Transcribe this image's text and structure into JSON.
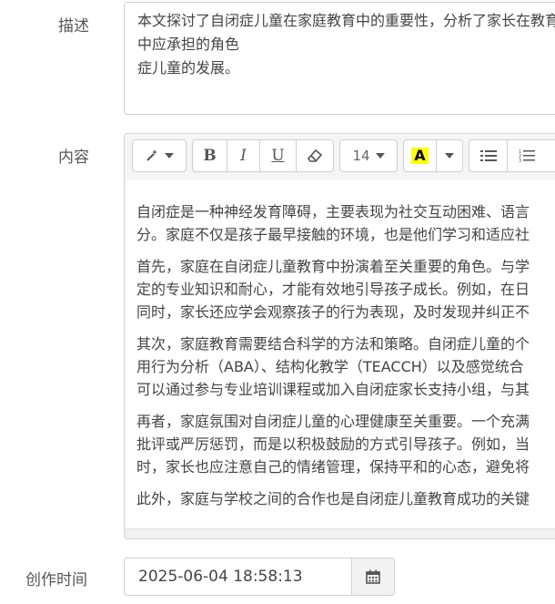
{
  "description": {
    "label": "描述",
    "value": "本文探讨了自闭症儿童在家庭教育中的重要性，分析了家长在教育中应承担的角色\n症儿童的发展。"
  },
  "content": {
    "label": "内容",
    "toolbar": {
      "font_size": "14",
      "bold": "B",
      "italic": "I",
      "underline": "U",
      "color_letter": "A",
      "highlight_color": "#ffff00"
    },
    "paragraphs": [
      [
        "自闭症是一种神经发育障碍，主要表现为社交互动困难、语言",
        "分。家庭不仅是孩子最早接触的环境，也是他们学习和适应社"
      ],
      [
        "首先，家庭在自闭症儿童教育中扮演着至关重要的角色。与学",
        "定的专业知识和耐心，才能有效地引导孩子成长。例如，在日",
        "同时，家长还应学会观察孩子的行为表现，及时发现并纠正不"
      ],
      [
        "其次，家庭教育需要结合科学的方法和策略。自闭症儿童的个",
        "用行为分析（ABA）、结构化教学（TEACCH）以及感觉统合",
        "可以通过参与专业培训课程或加入自闭症家长支持小组，与其"
      ],
      [
        "再者，家庭氛围对自闭症儿童的心理健康至关重要。一个充满",
        "批评或严厉惩罚，而是以积极鼓励的方式引导孩子。例如，当",
        "时，家长也应注意自己的情绪管理，保持平和的心态，避免将"
      ],
      [
        "此外，家庭与学校之间的合作也是自闭症儿童教育成功的关键"
      ]
    ]
  },
  "created_time": {
    "label": "创作时间",
    "value": "2025-06-04 18:58:13"
  }
}
